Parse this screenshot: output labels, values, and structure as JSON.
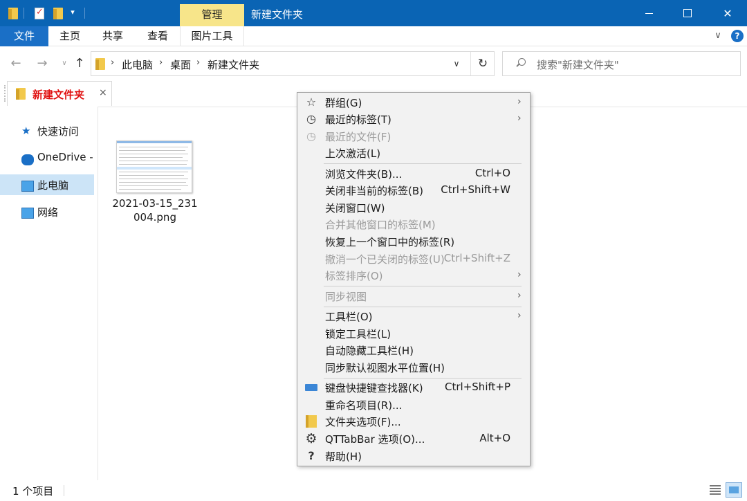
{
  "titlebar": {
    "manage_tab": "管理",
    "window_title": "新建文件夹",
    "minimize": "minimize",
    "maximize": "maximize",
    "close_glyph": "✕"
  },
  "ribbon": {
    "tabs": [
      {
        "label": "文件"
      },
      {
        "label": "主页"
      },
      {
        "label": "共享"
      },
      {
        "label": "查看"
      },
      {
        "label": "图片工具"
      }
    ],
    "expand_glyph": "∨",
    "help_glyph": "?"
  },
  "address": {
    "breadcrumb": [
      "此电脑",
      "桌面",
      "新建文件夹"
    ],
    "separator": "›",
    "search_placeholder": "搜索\"新建文件夹\""
  },
  "qttab": {
    "label": "新建文件夹",
    "close_glyph": "×"
  },
  "nav_pane": {
    "items": [
      {
        "label": "快速访问",
        "icon": "star-icon"
      },
      {
        "label": "OneDrive -",
        "icon": "cloud-icon"
      },
      {
        "label": "此电脑",
        "icon": "pc-icon",
        "selected": true
      },
      {
        "label": "网络",
        "icon": "network-icon"
      }
    ]
  },
  "content": {
    "file_name": "2021-03-15_231004.png"
  },
  "statusbar": {
    "count": "1 个项目"
  },
  "context_menu": {
    "items": [
      {
        "label": "群组(G)",
        "icon": "star-icon",
        "submenu": true
      },
      {
        "label": "最近的标签(T)",
        "icon": "clock-icon",
        "submenu": true
      },
      {
        "label": "最近的文件(F)",
        "icon": "clock-icon",
        "disabled": true
      },
      {
        "label": "上次激活(L)"
      },
      {
        "label": "浏览文件夹(B)...",
        "shortcut": "Ctrl+O"
      },
      {
        "label": "关闭非当前的标签(B)",
        "shortcut": "Ctrl+Shift+W"
      },
      {
        "label": "关闭窗口(W)"
      },
      {
        "label": "合并其他窗口的标签(M)",
        "disabled": true
      },
      {
        "label": "恢复上一个窗口中的标签(R)"
      },
      {
        "label": "撤消一个已关闭的标签(U)",
        "shortcut": "Ctrl+Shift+Z",
        "disabled": true
      },
      {
        "label": "标签排序(O)",
        "submenu": true,
        "disabled": true
      },
      {
        "label": "同步视图",
        "submenu": true,
        "disabled": true
      },
      {
        "label": "工具栏(O)",
        "submenu": true
      },
      {
        "label": "锁定工具栏(L)"
      },
      {
        "label": "自动隐藏工具栏(H)"
      },
      {
        "label": "同步默认视图水平位置(H)"
      },
      {
        "label": "键盘快捷键查找器(K)",
        "shortcut": "Ctrl+Shift+P",
        "icon": "keyboard-icon"
      },
      {
        "label": "重命名项目(R)..."
      },
      {
        "label": "文件夹选项(F)...",
        "icon": "folder-options-icon"
      },
      {
        "label": "QTTabBar 选项(O)...",
        "shortcut": "Alt+O",
        "icon": "gear-icon"
      },
      {
        "label": "帮助(H)",
        "icon": "help-icon"
      }
    ],
    "submenu_glyph": "›"
  },
  "colors": {
    "titlebar": "#0a64b4",
    "manage_tab": "#f7e58a",
    "qttab_label": "#e01010",
    "nav_selected": "#cce4f7",
    "menu_bg": "#f2f2f2"
  }
}
